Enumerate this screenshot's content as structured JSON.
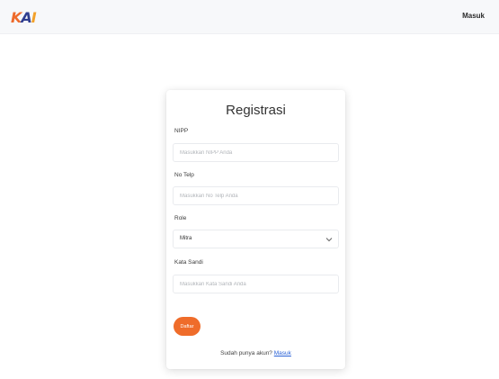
{
  "navbar": {
    "logo_letters": [
      "K",
      "A",
      "I"
    ],
    "login_label": "Masuk"
  },
  "card": {
    "title": "Registrasi",
    "fields": {
      "nipp": {
        "label": "NIPP",
        "placeholder": "Masukkan NIPP Anda"
      },
      "phone": {
        "label": "No Telp",
        "placeholder": "Masukkan No Telp Anda"
      },
      "role": {
        "label": "Role",
        "selected": "Mitra"
      },
      "email": {
        "label": "Kata Sandi",
        "placeholder": "Masukkan Kata Sandi Anda"
      }
    },
    "submit_label": "Daftar",
    "footer_prompt": "Sudah punya akun?",
    "footer_link": "Masuk"
  },
  "colors": {
    "brand_orange": "#ef6c2a",
    "brand_blue": "#2f3d8f",
    "brand_yellow": "#f2a12a",
    "link_blue": "#2a62d6"
  },
  "icons": {
    "select_chevron": "chevron-down-icon"
  }
}
